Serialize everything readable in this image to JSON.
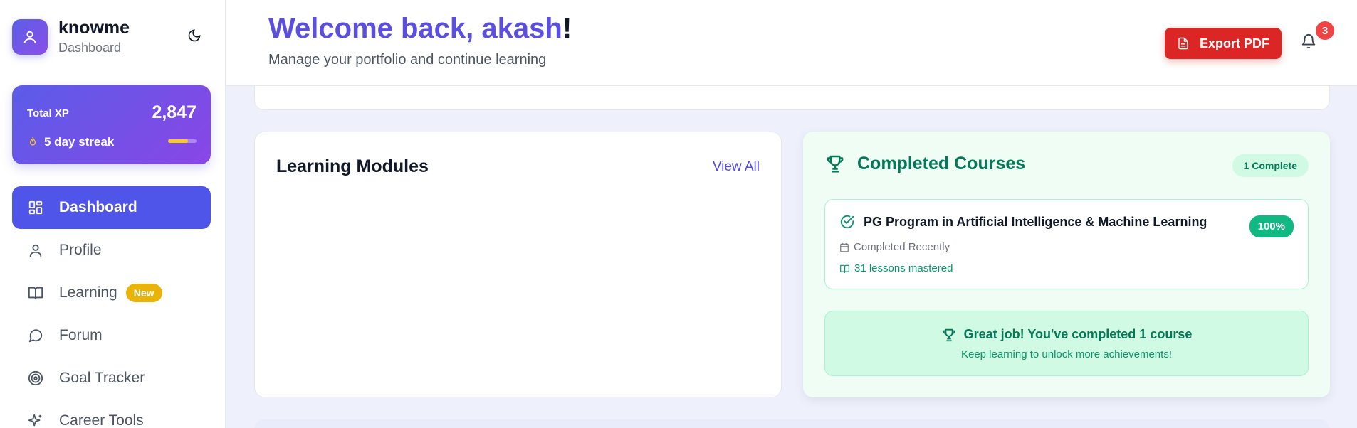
{
  "brand": {
    "name": "knowme",
    "subtitle": "Dashboard",
    "icon": "user-icon",
    "theme_icon": "moon-icon"
  },
  "xp": {
    "label": "Total XP",
    "value": "2,847",
    "streak": "5 day streak",
    "streak_icon": "flame-icon",
    "progress": 0.7
  },
  "sidebar": {
    "items": [
      {
        "label": "Dashboard",
        "icon": "grid-icon",
        "active": true
      },
      {
        "label": "Profile",
        "icon": "user-icon"
      },
      {
        "label": "Learning",
        "icon": "book-open-icon",
        "badge": "New"
      },
      {
        "label": "Forum",
        "icon": "chat-icon"
      },
      {
        "label": "Goal Tracker",
        "icon": "target-icon"
      },
      {
        "label": "Career Tools",
        "icon": "sparkles-icon"
      }
    ]
  },
  "header": {
    "welcome_prefix": "Welcome back, ",
    "username": "akash",
    "welcome_suffix": "!",
    "subtitle": "Manage your portfolio and continue learning",
    "export_label": "Export PDF",
    "notification_count": "3"
  },
  "modules": {
    "title": "Learning Modules",
    "view_all": "View All"
  },
  "completed": {
    "title": "Completed Courses",
    "count_label": "1 Complete",
    "course": {
      "name": "PG Program in Artificial Intelligence & Machine Learning",
      "percent": "100%",
      "date": "Completed Recently",
      "lessons": "31 lessons mastered"
    },
    "congrats_title": "Great job! You've completed 1 course",
    "congrats_sub": "Keep learning to unlock more achievements!"
  },
  "colors": {
    "accent": "#4f55e8",
    "success": "#10b981",
    "danger": "#dc2626",
    "warning": "#eab308"
  }
}
